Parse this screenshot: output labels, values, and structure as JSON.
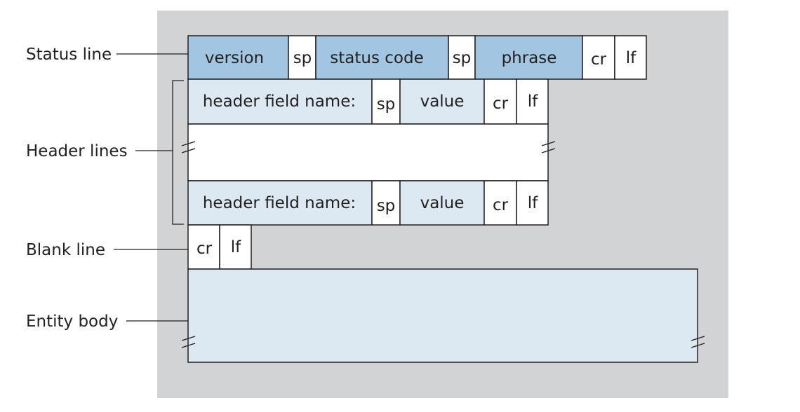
{
  "labels": {
    "status_line": "Status line",
    "header_lines": "Header lines",
    "blank_line": "Blank line",
    "entity_body": "Entity body"
  },
  "status_row": [
    "version",
    "sp",
    "status code",
    "sp",
    "phrase",
    "cr",
    "lf"
  ],
  "header_row_1": [
    "header field name:",
    "sp",
    "value",
    "cr",
    "lf"
  ],
  "header_row_2": [
    "header field name:",
    "sp",
    "value",
    "cr",
    "lf"
  ],
  "blank_row": [
    "cr",
    "lf"
  ],
  "colors": {
    "background": "#d1d3d4",
    "status_fill": "#a2c6e1",
    "header_fill": "#dce9f3",
    "separator_fill": "#ffffff"
  }
}
